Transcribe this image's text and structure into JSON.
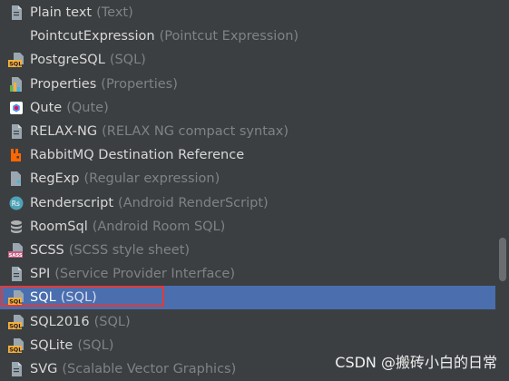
{
  "items": [
    {
      "name": "Plain text",
      "hint": "(Text)",
      "icon": "file-text-icon"
    },
    {
      "name": "PointcutExpression",
      "hint": "(Pointcut Expression)",
      "icon": ""
    },
    {
      "name": "PostgreSQL",
      "hint": "(SQL)",
      "icon": "sql-file-icon"
    },
    {
      "name": "Properties",
      "hint": "(Properties)",
      "icon": "properties-file-icon"
    },
    {
      "name": "Qute",
      "hint": "(Qute)",
      "icon": "qute-icon"
    },
    {
      "name": "RELAX-NG",
      "hint": "(RELAX NG compact syntax)",
      "icon": "file-text-icon"
    },
    {
      "name": "RabbitMQ Destination Reference",
      "hint": "",
      "icon": "rabbitmq-icon"
    },
    {
      "name": "RegExp",
      "hint": "(Regular expression)",
      "icon": "regexp-file-icon"
    },
    {
      "name": "Renderscript",
      "hint": "(Android RenderScript)",
      "icon": "renderscript-icon"
    },
    {
      "name": "RoomSql",
      "hint": "(Android Room SQL)",
      "icon": "database-icon"
    },
    {
      "name": "SCSS",
      "hint": "(SCSS style sheet)",
      "icon": "sass-file-icon"
    },
    {
      "name": "SPI",
      "hint": "(Service Provider Interface)",
      "icon": "file-text-icon"
    },
    {
      "name": "SQL",
      "hint": "(SQL)",
      "icon": "sql-file-icon",
      "selected": true
    },
    {
      "name": "SQL2016",
      "hint": "(SQL)",
      "icon": "sql-file-icon"
    },
    {
      "name": "SQLite",
      "hint": "(SQL)",
      "icon": "sql-file-icon"
    },
    {
      "name": "SVG",
      "hint": "(Scalable Vector Graphics)",
      "icon": "file-text-icon"
    }
  ],
  "watermark": "CSDN @搬砖小白的日常",
  "colors": {
    "background": "#3c3f41",
    "selection": "#4b6eaf",
    "highlight_outline": "#e53935"
  }
}
